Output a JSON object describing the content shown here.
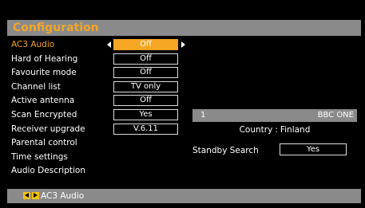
{
  "header": {
    "title": "Configuration"
  },
  "menu": {
    "items": [
      {
        "label": "AC3 Audio",
        "value": "Off"
      },
      {
        "label": "Hard of Hearing",
        "value": "Off"
      },
      {
        "label": "Favourite mode",
        "value": "Off"
      },
      {
        "label": "Channel list",
        "value": "TV only"
      },
      {
        "label": "Active antenna",
        "value": "Off"
      },
      {
        "label": "Scan Encrypted",
        "value": "Yes"
      },
      {
        "label": "Receiver upgrade",
        "value": "V.6.11"
      },
      {
        "label": "Parental control"
      },
      {
        "label": "Time settings"
      },
      {
        "label": "Audio Description"
      }
    ]
  },
  "preview": {
    "channel_number": "1",
    "channel_name": "BBC ONE"
  },
  "country": {
    "label": "Country",
    "separator": ":",
    "value": "Finland"
  },
  "standby": {
    "label": "Standby Search",
    "value": "Yes"
  },
  "footer": {
    "hint": "AC3 Audio"
  },
  "colors": {
    "accent": "#f5a623",
    "bar": "#8a8a8a",
    "background": "#000000"
  }
}
